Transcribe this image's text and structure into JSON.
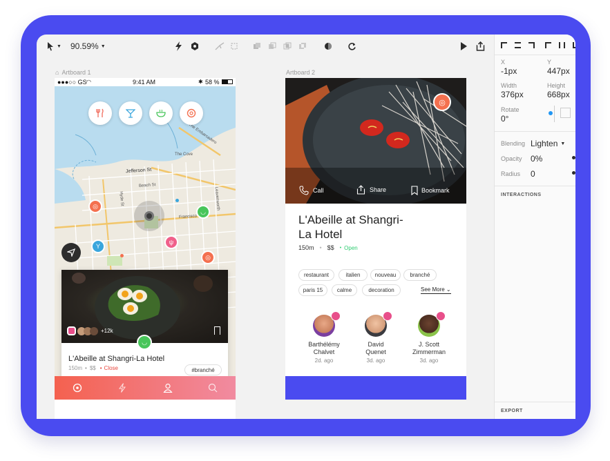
{
  "toolbar": {
    "zoom": "90.59%"
  },
  "artboards": [
    {
      "label": "Artboard 1"
    },
    {
      "label": "Artboard 2"
    }
  ],
  "artboard1": {
    "status": {
      "carrier": "●●●○○ GS",
      "time": "9:41 AM",
      "battery": "58 %"
    },
    "map_labels": {
      "jefferson": "Jefferson St",
      "beach": "Beach St",
      "francisco": "Francisco St",
      "hyde": "Hyde St",
      "leavenworth": "Leavenworth",
      "pier": "The Embarcadero",
      "cove": "The Cove",
      "steiner": "Battery St"
    },
    "card": {
      "count": "+12k",
      "title": "L'Abeille at Shangri-La Hotel",
      "distance": "150m",
      "price": "$$",
      "status": "Close",
      "tag": "#branché"
    }
  },
  "artboard2": {
    "status": "Open",
    "actions": {
      "call": "Call",
      "share": "Share",
      "bookmark": "Bookmark"
    },
    "title_line1": "L'Abeille at Shangri-",
    "title_line2": "La Hotel",
    "distance": "150m",
    "price": "$$",
    "tags": [
      "restaurant",
      "italien",
      "nouveau",
      "branché",
      "paris 15",
      "calme",
      "decoration"
    ],
    "see_more": "See More",
    "people": [
      {
        "name1": "Barthélémy",
        "name2": "Chalvet",
        "ago": "2d. ago"
      },
      {
        "name1": "David",
        "name2": "Quenet",
        "ago": "3d. ago"
      },
      {
        "name1": "J. Scott",
        "name2": "Zimmerman",
        "ago": "3d. ago"
      }
    ]
  },
  "inspector": {
    "x_label": "X",
    "x_value": "-1px",
    "y_label": "Y",
    "y_value": "447px",
    "width_label": "Width",
    "width_value": "376px",
    "height_label": "Height",
    "height_value": "668px",
    "rotate_label": "Rotate",
    "rotate_value": "0°",
    "blending_label": "Blending",
    "blending_value": "Lighten",
    "opacity_label": "Opacity",
    "opacity_value": "0%",
    "radius_label": "Radius",
    "radius_value": "0",
    "interactions": "INTERACTIONS",
    "export": "EXPORT"
  },
  "colors": {
    "frame": "#4a4bf0",
    "accent_orange": "#f4704f",
    "open_green": "#2ecc71",
    "close_red": "#e8453c",
    "footer_blue": "#4a4bf0"
  }
}
